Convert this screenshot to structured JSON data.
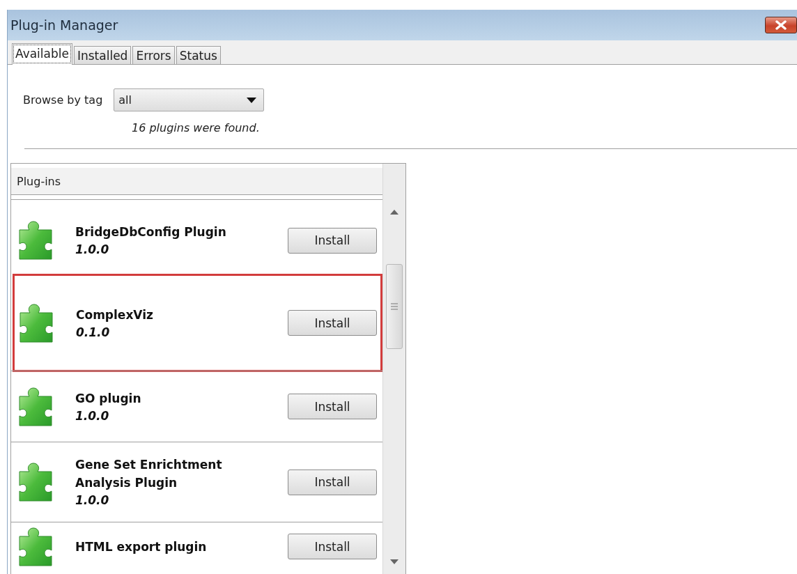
{
  "window": {
    "title": "Plug-in Manager"
  },
  "tabs": [
    {
      "label": "Available",
      "selected": true
    },
    {
      "label": "Installed",
      "selected": false
    },
    {
      "label": "Errors",
      "selected": false
    },
    {
      "label": "Status",
      "selected": false
    }
  ],
  "browse": {
    "label": "Browse by tag",
    "value": "all",
    "result": "16 plugins were found."
  },
  "list": {
    "header": "Plug-ins",
    "rows": [
      {
        "name": "BridgeDbConfig Plugin",
        "version": "1.0.0",
        "button": "Install",
        "highlighted": false
      },
      {
        "name": "ComplexViz",
        "version": "0.1.0",
        "button": "Install",
        "highlighted": true
      },
      {
        "name": "GO plugin",
        "version": "1.0.0",
        "button": "Install",
        "highlighted": false
      },
      {
        "name": "Gene Set Enrichtment Analysis Plugin",
        "version": "1.0.0",
        "button": "Install",
        "highlighted": false
      },
      {
        "name": "HTML export plugin",
        "button": "Install",
        "highlighted": false
      }
    ]
  }
}
